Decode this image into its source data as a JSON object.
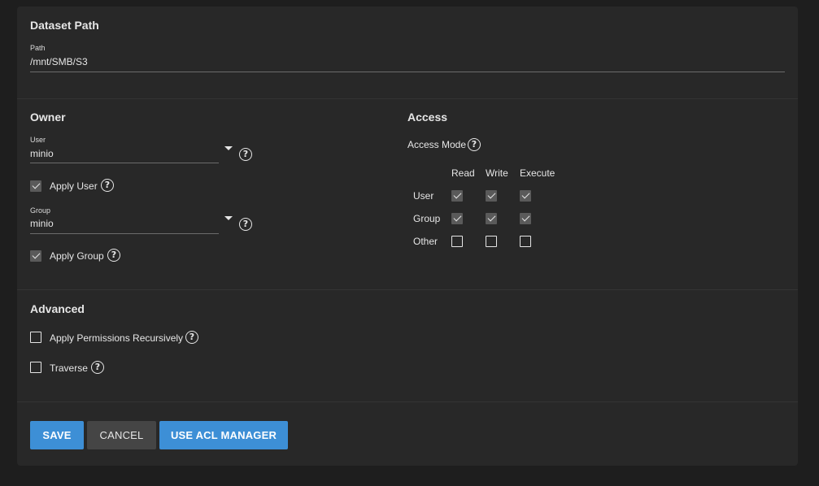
{
  "dataset_path": {
    "title": "Dataset Path",
    "path_label": "Path",
    "path_value": "/mnt/SMB/S3"
  },
  "owner": {
    "title": "Owner",
    "user_label": "User",
    "user_value": "minio",
    "apply_user_label": "Apply User",
    "apply_user_checked": true,
    "group_label": "Group",
    "group_value": "minio",
    "apply_group_label": "Apply Group",
    "apply_group_checked": true
  },
  "access": {
    "title": "Access",
    "mode_label": "Access Mode",
    "columns": [
      "Read",
      "Write",
      "Execute"
    ],
    "rows": [
      {
        "label": "User",
        "values": [
          true,
          true,
          true
        ]
      },
      {
        "label": "Group",
        "values": [
          true,
          true,
          true
        ]
      },
      {
        "label": "Other",
        "values": [
          false,
          false,
          false
        ]
      }
    ]
  },
  "advanced": {
    "title": "Advanced",
    "recursive_label": "Apply Permissions Recursively",
    "recursive_checked": false,
    "traverse_label": "Traverse",
    "traverse_checked": false
  },
  "actions": {
    "save": "SAVE",
    "cancel": "CANCEL",
    "acl_manager": "USE ACL MANAGER"
  },
  "icons": {
    "help": "help-circle-icon",
    "dropdown": "caret-down-icon",
    "check": "check-icon"
  },
  "colors": {
    "background": "#1e1e1e",
    "card": "#282828",
    "primary": "#3d8fd6",
    "secondary_button": "#454545"
  }
}
